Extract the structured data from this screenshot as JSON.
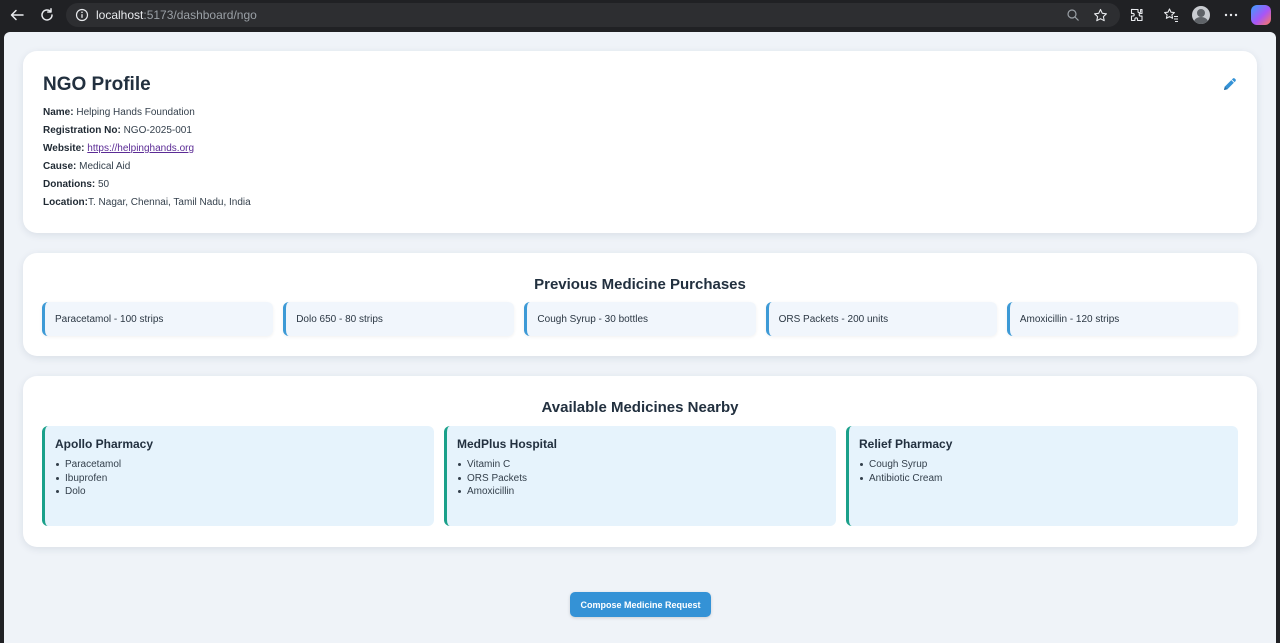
{
  "browser": {
    "url_host": "localhost",
    "url_path": ":5173/dashboard/ngo"
  },
  "profile": {
    "title": "NGO Profile",
    "fields": [
      {
        "label": "Name:",
        "value": "Helping Hands Foundation"
      },
      {
        "label": "Registration No:",
        "value": "NGO-2025-001"
      },
      {
        "label": "Website:",
        "value": "https://helpinghands.org"
      },
      {
        "label": "Cause:",
        "value": "Medical Aid"
      },
      {
        "label": "Donations:",
        "value": "50"
      },
      {
        "label": "Location:",
        "value": "T. Nagar, Chennai, Tamil Nadu, India"
      }
    ]
  },
  "purchases": {
    "title": "Previous Medicine Purchases",
    "items": [
      "Paracetamol - 100 strips",
      "Dolo 650 - 80 strips",
      "Cough Syrup - 30 bottles",
      "ORS Packets - 200 units",
      "Amoxicillin - 120 strips"
    ]
  },
  "nearby": {
    "title": "Available Medicines Nearby",
    "pharmacies": [
      {
        "name": "Apollo Pharmacy",
        "medicines": [
          "Paracetamol",
          "Ibuprofen",
          "Dolo"
        ]
      },
      {
        "name": "MedPlus Hospital",
        "medicines": [
          "Vitamin C",
          "ORS Packets",
          "Amoxicillin"
        ]
      },
      {
        "name": "Relief Pharmacy",
        "medicines": [
          "Cough Syrup",
          "Antibiotic Cream"
        ]
      }
    ]
  },
  "actions": {
    "compose_label": "Compose Medicine Request"
  },
  "colors": {
    "accent": "#3492d6",
    "pharmacy_border": "#1aa08a",
    "page_bg": "#eff3f8"
  }
}
